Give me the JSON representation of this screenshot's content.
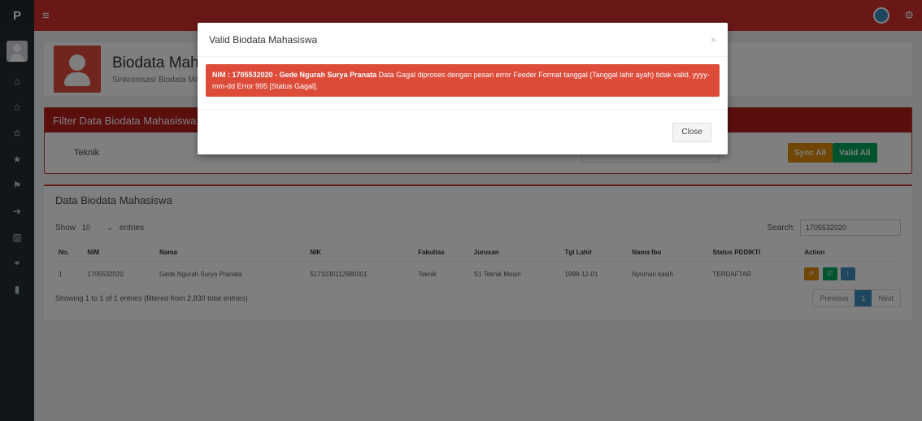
{
  "sidebar": {
    "brand": "P",
    "icons": [
      "home-icon",
      "star-outline-icon",
      "star-half-icon",
      "star-icon",
      "flag-icon",
      "sign-in-icon",
      "chart-icon",
      "share-icon",
      "bookmark-icon"
    ]
  },
  "topbar": {
    "menu_glyph": "≡",
    "gear_glyph": "⚙"
  },
  "page_header": {
    "title": "Biodata Mahasiswa",
    "subtitle": "Sinkronisasi Biodata Mahasiswa"
  },
  "filter": {
    "title": "Filter Data Biodata Mahasiswa",
    "fakultas_value": "Teknik",
    "sync_all_label": "Sync All",
    "valid_all_label": "Valid All",
    "dropdown_caret": "▾"
  },
  "data": {
    "title": "Data Biodata Mahasiswa",
    "show_label": "Show",
    "entries_value": "10",
    "entries_label": "entries",
    "search_label": "Search:",
    "search_value": "1705532020",
    "columns": [
      "No.",
      "NIM",
      "Nama",
      "NIK",
      "Fakultas",
      "Jurusan",
      "Tgl Lahir",
      "Nama Ibu",
      "Status PDDIKTI",
      "Action"
    ],
    "rows": [
      {
        "no": "1",
        "nim": "1705532020",
        "nama": "Gede Ngurah Surya Pranata",
        "nik": "5171030112980001",
        "fakultas": "Teknik",
        "jurusan": "S1 Teknik Mesin",
        "tgl_lahir": "1998-12-01",
        "nama_ibu": "Nyoman kasih",
        "status": "TERDAFTAR"
      }
    ],
    "info": "Showing 1 to 1 of 1 entries (filtered from 2,830 total entries)",
    "pager": {
      "previous": "Previous",
      "page": "1",
      "next": "Next"
    }
  },
  "modal": {
    "title": "Valid Biodata Mahasiswa",
    "close_glyph": "×",
    "alert_bold": "NIM : 1705532020 - Gede Ngurah Surya Pranata",
    "alert_text": " Data Gagal diproses dengan pesan error Feeder Format tanggal (Tanggal lahir ayah) tidak valid. yyyy-mm-dd Error 995 [Status Gagal].",
    "close_label": "Close"
  },
  "colors": {
    "topbar": "#d32f2f",
    "alert": "#dd4b39",
    "sync": "#e08e0b",
    "valid": "#00a65a",
    "info": "#3c8dbc"
  }
}
